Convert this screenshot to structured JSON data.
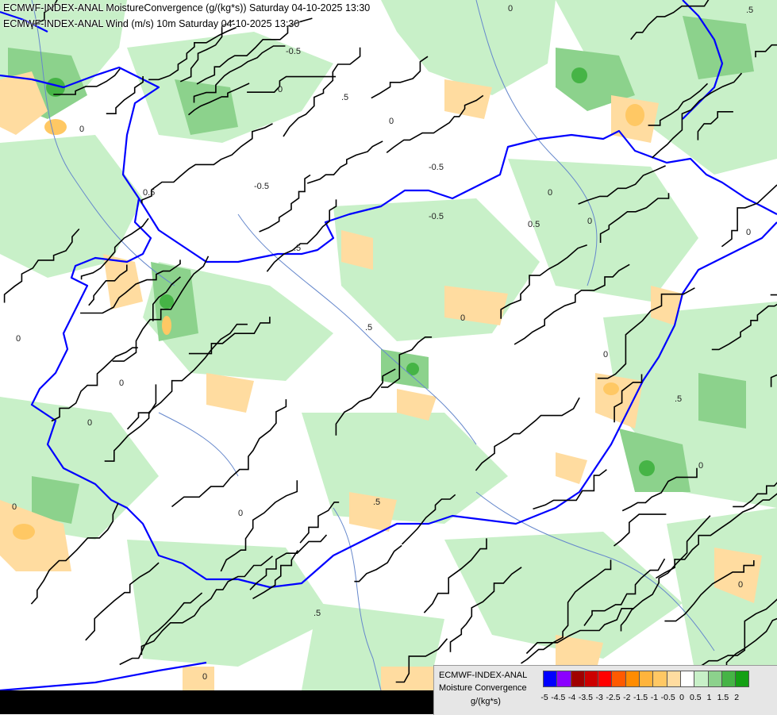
{
  "header": {
    "line1": "ECMWF-INDEX-ANAL MoistureConvergence (g/(kg*s)) Saturday 04-10-2025 13:30",
    "line2": "ECMWF-INDEX-ANAL Wind (m/s) 10m Saturday 04-10-2025 13:30"
  },
  "legend": {
    "model": "ECMWF-INDEX-ANAL",
    "parameter": "Moisture Convergence",
    "unit": "g/(kg*s)",
    "ticks": [
      "-5",
      "-4.5",
      "-4",
      "-3.5",
      "-3",
      "-2.5",
      "-2",
      "-1.5",
      "-1",
      "-0.5",
      "0",
      "0.5",
      "1",
      "1.5",
      "2"
    ],
    "colors": [
      "#0000ff",
      "#8b00ff",
      "#a00000",
      "#cc0000",
      "#ff0000",
      "#ff5a00",
      "#ff8c00",
      "#ffb43c",
      "#ffc864",
      "#ffdca0",
      "#ffffff",
      "#c8f0c8",
      "#8cd28c",
      "#46b446",
      "#14a014"
    ]
  },
  "map": {
    "contour_labels": [
      ".5",
      "0",
      "-0.5",
      ".5",
      "0",
      "-0.5",
      "0",
      "0",
      "-0.5",
      "0",
      "0.5",
      ".5",
      "0",
      "0",
      "0",
      ".5",
      "0",
      ".5",
      "0",
      "0",
      "0",
      ".5",
      "0",
      "0",
      ".5",
      "0",
      "0",
      "-0.5",
      "0",
      "0.5"
    ],
    "colors": {
      "positive_light": "#c8f0c8",
      "positive_mid": "#8cd28c",
      "positive_dark": "#46b446",
      "negative_light": "#ffdca0",
      "negative_mid": "#ffc864",
      "border": "#0000ff",
      "rivers": "#6688cc",
      "streamlines": "#000000"
    }
  }
}
